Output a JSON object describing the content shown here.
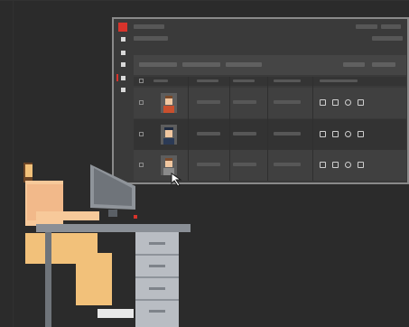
{
  "scene": {
    "description_free": true
  },
  "colors": {
    "background": "#2b2b2b",
    "panel_bg": "#3a3a3a",
    "panel_border": "#8a8a8a",
    "brand_accent": "#d7332b",
    "skin": "#f7c99a",
    "shirt": "#f2c17a",
    "hair": "#6b4426",
    "desk": "#8a8f96",
    "drawers": "#b9bdc3"
  },
  "table": {
    "rows": [
      {
        "avatar": "person-avatar-brown-hair-icon"
      },
      {
        "avatar": "person-avatar-police-cap-icon"
      },
      {
        "avatar": "person-avatar-brown-hair-icon"
      }
    ],
    "row_actions": [
      "document-icon",
      "scan-icon",
      "bug-icon",
      "grid-icon"
    ]
  },
  "icons": {
    "cursor": "mouse-pointer-icon"
  }
}
